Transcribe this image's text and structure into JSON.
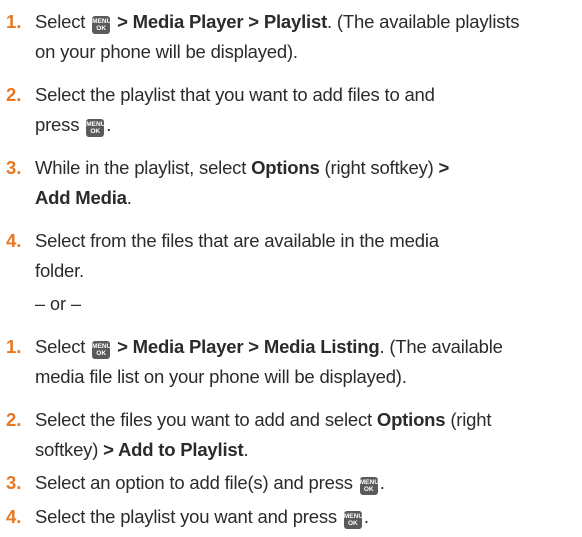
{
  "menu_key": {
    "icon": "menu-ok-key-icon",
    "top_text": "MENU",
    "bottom_text": "OK"
  },
  "list_a": [
    {
      "num": "1.",
      "parts": [
        "Select ",
        "",
        " > Media Player > Playlist",
        ". (The available playlists",
        "on your phone will be displayed)."
      ]
    },
    {
      "num": "2.",
      "parts": [
        "Select the playlist that you want to add files to and",
        "press ",
        ""
      ]
    },
    {
      "num": "3.",
      "parts": [
        "While in the playlist, select ",
        "Options",
        " (right softkey) ",
        ">",
        "Add Media",
        "."
      ]
    },
    {
      "num": "4.",
      "parts": [
        "Select from the files that are available in the media",
        "folder."
      ]
    }
  ],
  "or_text": "– or –",
  "list_b": [
    {
      "num": "1.",
      "parts": [
        "Select ",
        "",
        " > Media Player > Media Listing",
        ". (The available",
        "media file list on your phone will be displayed)."
      ]
    },
    {
      "num": "2.",
      "parts": [
        "Select the files you want to add and select ",
        "Options",
        " (right",
        "softkey) ",
        "> Add to Playlist",
        "."
      ]
    },
    {
      "num": "3.",
      "parts": [
        "Select an option to add file(s) and press ",
        ""
      ]
    },
    {
      "num": "4.",
      "parts": [
        "Select the playlist you want and press ",
        ""
      ]
    }
  ]
}
